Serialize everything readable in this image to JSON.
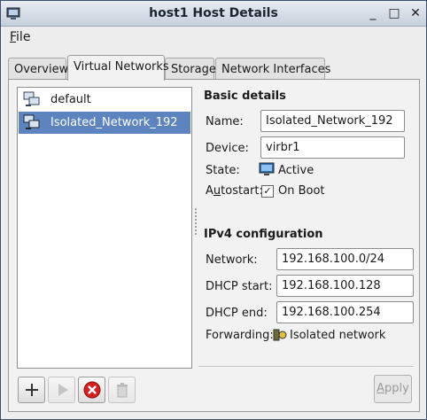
{
  "window": {
    "title": "host1 Host Details",
    "title_icon": "computer-icon",
    "buttons": {
      "minimize": "_",
      "maximize": "□",
      "close": "✕"
    }
  },
  "menubar": {
    "file_prefix": "F",
    "file_rest": "ile"
  },
  "tabs": [
    {
      "label": "Overview"
    },
    {
      "label": "Virtual Networks",
      "active": true
    },
    {
      "label": "Storage"
    },
    {
      "label": "Network Interfaces"
    }
  ],
  "networks": [
    {
      "label": "default",
      "selected": false
    },
    {
      "label": "Isolated_Network_192",
      "selected": true
    }
  ],
  "basic": {
    "heading": "Basic details",
    "name_label": "Name:",
    "name_value": "Isolated_Network_192",
    "device_label": "Device:",
    "device_value": "virbr1",
    "state_label": "State:",
    "state_value": "Active",
    "autostart_label_pre": "A",
    "autostart_label_u": "u",
    "autostart_label_post": "tostart:",
    "autostart_checked": true,
    "autostart_value": "On Boot"
  },
  "ipv4": {
    "heading": "IPv4 configuration",
    "network_label": "Network:",
    "network_value": "192.168.100.0/24",
    "dhcp_start_label": "DHCP start:",
    "dhcp_start_value": "192.168.100.128",
    "dhcp_end_label": "DHCP end:",
    "dhcp_end_value": "192.168.100.254",
    "forwarding_label": "Forwarding:",
    "forwarding_value": "Isolated network"
  },
  "toolbar": {
    "apply_prefix": "A",
    "apply_rest": "pply"
  },
  "colors": {
    "selection": "#5d84bf",
    "delete_red": "#d62020"
  }
}
